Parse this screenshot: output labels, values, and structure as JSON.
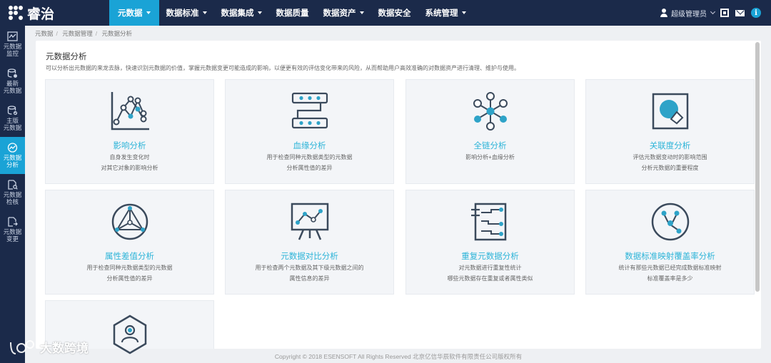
{
  "brand": {
    "name": "睿治"
  },
  "nav": [
    {
      "label": "元数据",
      "active": true,
      "dropdown": true
    },
    {
      "label": "数据标准",
      "active": false,
      "dropdown": true
    },
    {
      "label": "数据集成",
      "active": false,
      "dropdown": true
    },
    {
      "label": "数据质量",
      "active": false,
      "dropdown": false
    },
    {
      "label": "数据资产",
      "active": false,
      "dropdown": true
    },
    {
      "label": "数据安全",
      "active": false,
      "dropdown": false
    },
    {
      "label": "系统管理",
      "active": false,
      "dropdown": true
    }
  ],
  "user": {
    "name": "超级管理员"
  },
  "sidebar": [
    {
      "line1": "元数据",
      "line2": "监控",
      "icon": "monitor-chart-icon"
    },
    {
      "line1": "最新",
      "line2": "元数据",
      "icon": "database-new-icon"
    },
    {
      "line1": "主版",
      "line2": "元数据",
      "icon": "database-check-icon"
    },
    {
      "line1": "元数据",
      "line2": "分析",
      "icon": "analysis-chart-icon",
      "active": true
    },
    {
      "line1": "元数据",
      "line2": "检核",
      "icon": "document-search-icon"
    },
    {
      "line1": "元数据",
      "line2": "变更",
      "icon": "document-change-icon"
    }
  ],
  "breadcrumb": [
    "元数据",
    "元数据管理",
    "元数据分析"
  ],
  "page": {
    "title": "元数据分析",
    "description": "可以分析出元数据的来龙去脉，快速识别元数据的价值，掌握元数据变更可能造成的影响，以便更有效的评估变化带来的风险，从而帮助用户高效准确的对数据资产进行清理、维护与使用。"
  },
  "cards": [
    {
      "title": "影响分析",
      "d1": "自身发生变化时",
      "d2": "对其它对象的影响分析",
      "icon": "impact-graph-icon"
    },
    {
      "title": "血缘分析",
      "d1": "用于检查同种元数据类型的元数据",
      "d2": "分析属性值的差异",
      "icon": "lineage-flow-icon"
    },
    {
      "title": "全链分析",
      "d1": "影响分析+血缘分析",
      "d2": "",
      "icon": "full-chain-icon"
    },
    {
      "title": "关联度分析",
      "d1": "评估元数据变动时的影响范围",
      "d2": "分析元数据的重要程度",
      "icon": "relevance-icon"
    },
    {
      "title": "属性差值分析",
      "d1": "用于检查同种元数据类型的元数据",
      "d2": "分析属性值的差异",
      "icon": "attribute-diff-icon"
    },
    {
      "title": "元数据对比分析",
      "d1": "用于检查两个元数据及其下级元数据之间的",
      "d2": "属性信息的差异",
      "icon": "compare-board-icon"
    },
    {
      "title": "重复元数据分析",
      "d1": "对元数据进行重复性统计",
      "d2": "哪些元数据存在重复或者属性类似",
      "icon": "duplicate-doc-icon"
    },
    {
      "title": "数据标准映射覆盖率分析",
      "d1": "统计有那些元数据已经完成数据标准映射",
      "d2": "标准覆盖率是多少",
      "icon": "coverage-graph-icon"
    },
    {
      "title": "",
      "d1": "",
      "d2": "",
      "icon": "user-hexagon-icon"
    }
  ],
  "footer": "Copyright © 2018 ESENSOFT All Rights Reserved 北京亿信华辰软件有限责任公司版权所有",
  "watermark": "大数跨境",
  "colors": {
    "topbar": "#1b2a4a",
    "accent": "#1aa3d6",
    "cardTitle": "#2db4d8",
    "iconDark": "#3b4a5c"
  }
}
